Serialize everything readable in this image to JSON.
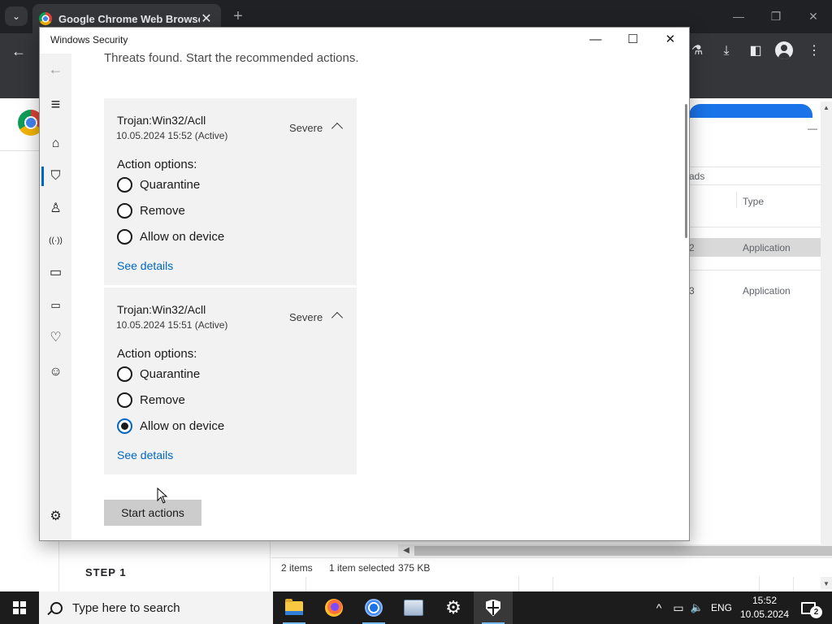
{
  "chrome": {
    "tab_title": "Google Chrome Web Browser",
    "tab_close": "✕",
    "new_tab": "+",
    "tab_dropdown": "⌄",
    "win_min": "—",
    "win_restore": "❐",
    "win_close": "✕",
    "back": "←",
    "toolbar_icons": [
      "flask-icon",
      "download-icon",
      "sidepanel-icon",
      "profile-icon",
      "menu-icon"
    ],
    "toolbar_glyphs": {
      "flask": "⚗",
      "download": "⤓",
      "sidepanel": "◧",
      "menu": "⋮"
    }
  },
  "background_page": {
    "column_partial": "ads",
    "type_header": "Type",
    "row1": {
      "num": "2",
      "type": "Application"
    },
    "row2": {
      "num": "3",
      "type": "Application"
    },
    "status": {
      "items": "2 items",
      "selected": "1 item selected",
      "size": "375 KB"
    },
    "step": "STEP 1",
    "scroll_up": "▲",
    "scroll_down": "▼",
    "scroll_left": "◀",
    "minimize": "—"
  },
  "security_window": {
    "title": "Windows Security",
    "controls": {
      "minimize": "—",
      "maximize": "☐",
      "close": "✕"
    },
    "subtitle": "Threats found. Start the recommended actions.",
    "sidebar_glyphs": {
      "back": "←",
      "menu": "≡",
      "home": "⌂",
      "shield": "⛉",
      "account": "♙",
      "network": "((·))",
      "app_browser": "▭",
      "device": "▭",
      "health": "♡",
      "family": "☺",
      "settings": "⚙"
    },
    "threats": [
      {
        "name": "Trojan:Win32/Acll",
        "date": "10.05.2024 15:52 (Active)",
        "severity": "Severe",
        "action_label": "Action options:",
        "options": [
          "Quarantine",
          "Remove",
          "Allow on device"
        ],
        "selected": "",
        "details": "See details"
      },
      {
        "name": "Trojan:Win32/Acll",
        "date": "10.05.2024 15:51 (Active)",
        "severity": "Severe",
        "action_label": "Action options:",
        "options": [
          "Quarantine",
          "Remove",
          "Allow on device"
        ],
        "selected": "Allow on device",
        "details": "See details"
      }
    ],
    "start_button": "Start actions"
  },
  "taskbar": {
    "search_placeholder": "Type here to search",
    "apps": [
      "file-explorer-icon",
      "firefox-icon",
      "chrome-icon",
      "remote-desktop-icon",
      "settings-icon",
      "windows-security-icon"
    ],
    "settings_glyph": "⚙",
    "tray_chevron": "^",
    "tray_network": "▭",
    "tray_volume": "🔈",
    "language": "ENG",
    "time": "15:52",
    "date": "10.05.2024",
    "notification_count": "2"
  }
}
